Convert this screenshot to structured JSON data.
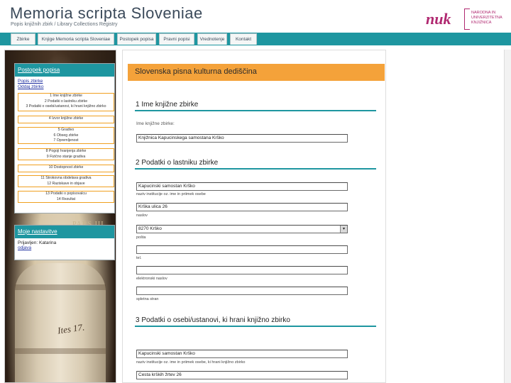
{
  "header": {
    "title": "Memoria scripta Sloveniae",
    "subtitle": "Popis knjižnih zbirk / Library Collections Registry",
    "logo_mark": "nuk",
    "logo_lines": [
      "NARODNA IN",
      "UNIVERZITETNA",
      "KNJIŽNICA"
    ]
  },
  "tabs": [
    "Zbirke",
    "Knjige Memoria scripta Sloveniae",
    "Postopek popisa",
    "Pravni popisi",
    "Vrednotenje",
    "Kontakt"
  ],
  "sidebar": {
    "panel_title": "Postopek popisa",
    "links": [
      "Popis zbirke",
      "Oddaj zbirko"
    ],
    "steps": [
      [
        "1 Ime knjižne zbirke",
        "2 Podatki o lastniku zbirke",
        "3 Podatki o osebi/ustanovi, ki hrani knjižno zbirko"
      ],
      [
        "4 Izvor knjižne zbirke"
      ],
      [
        "5 Gradivo",
        "6 Obseg zbirke",
        "7 Opremljenost"
      ],
      [
        "8 Pogoji hranjenja zbirke",
        "9 Fizično stanje gradiva"
      ],
      [
        "10 Dostopnost zbirke"
      ],
      [
        "11 Strokovna obdelava gradiva",
        "12 Raziskave in objave",
        "13 Podatki o popisovalcu"
      ],
      [
        "13 Podatki o popisovalcu",
        "14 Rezultat"
      ]
    ],
    "panel2_title": "Moje nastavitve",
    "panel2_text": "Prijavljen: Katarina",
    "panel2_link": "odjava"
  },
  "form": {
    "banner": "Slovenska pisna kulturna dediščina",
    "section1": "1 Ime knjižne zbirke",
    "name_label": "Ime knjižne zbirke:",
    "name_value": "Knjižnica Kapucinskega samostana Krško",
    "section2": "2 Podatki o lastniku zbirke",
    "owner_value": "Kapucinski samostan Krško",
    "owner_hint": "naziv institucije oz. ime in priimek osebe",
    "address_value": "Krška ulica 26",
    "address_hint": "naslov",
    "post_value": "8270 Krško",
    "post_hint": "pošta",
    "phone_hint": "tel.",
    "email_hint": "elektronski naslov",
    "web_hint": "spletna stran",
    "section3": "3 Podatki o osebi/ustanovi, ki hrani knjižno zbirko",
    "keeper_value": "Kapucinski samostan Krško",
    "keeper_hint": "naziv institucije oz. ime in priimek osebe, ki hrani knjižno zbirko",
    "keeper_address_value": "Cesta krških žrtev 26"
  },
  "colors": {
    "accent": "#1e96a0",
    "banner": "#f4a23a",
    "brand": "#b02870"
  }
}
